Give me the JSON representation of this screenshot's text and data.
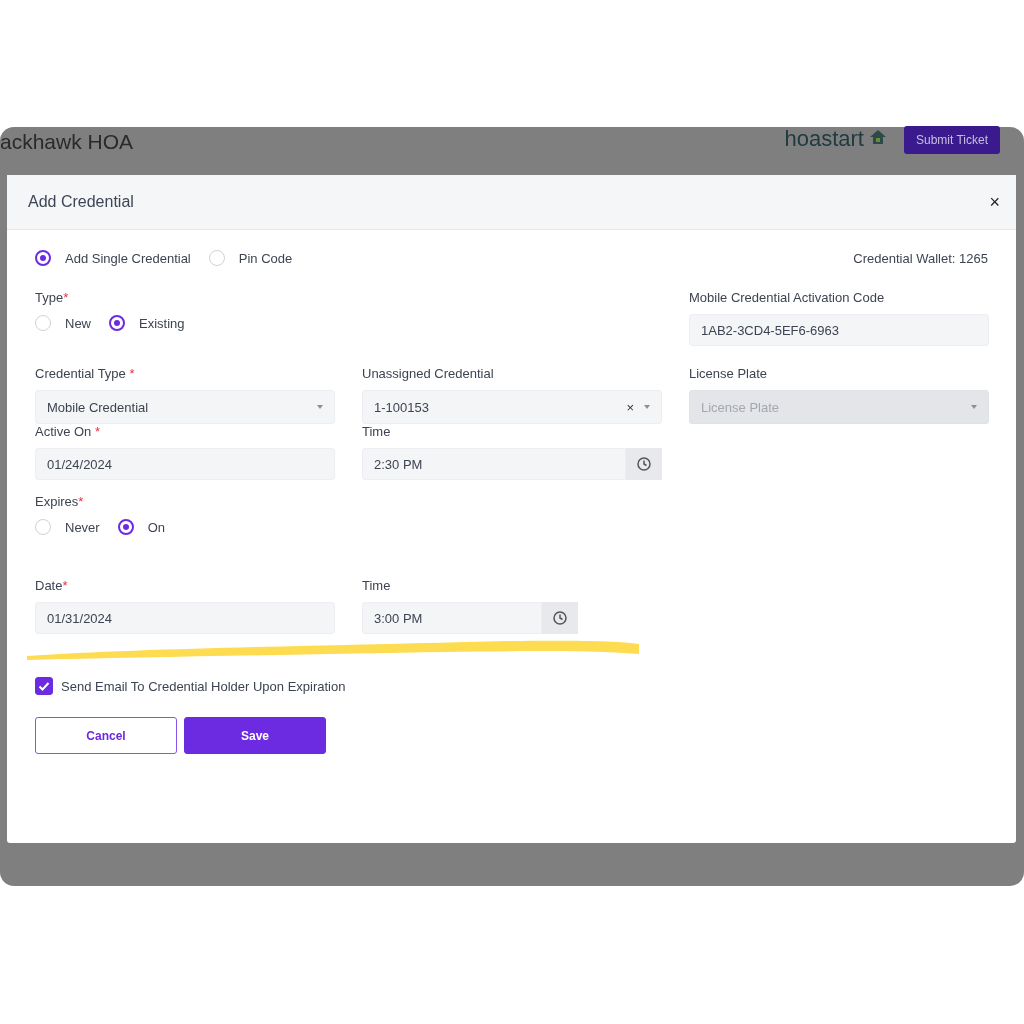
{
  "app_header": {
    "org_name": "ackhawk HOA",
    "logo_text": "hoastart",
    "submit_button": "Submit Ticket"
  },
  "modal": {
    "title": "Add Credential",
    "close": "×",
    "mode_options": [
      {
        "label": "Add Single Credential",
        "selected": true
      },
      {
        "label": "Pin Code",
        "selected": false
      }
    ],
    "wallet": "Credential Wallet: 1265",
    "type": {
      "label": "Type",
      "required_mark": "*",
      "options": [
        {
          "label": "New",
          "selected": false
        },
        {
          "label": "Existing",
          "selected": true
        }
      ]
    },
    "activation_code": {
      "label": "Mobile Credential Activation Code",
      "value": "1AB2-3CD4-5EF6-6963"
    },
    "credential_type": {
      "label": "Credential Type",
      "required_mark": "*",
      "value": "Mobile Credential"
    },
    "unassigned_credential": {
      "label": "Unassigned Credential",
      "value": "1-100153",
      "clear": "×"
    },
    "license_plate": {
      "label": "License Plate",
      "placeholder": "License Plate",
      "disabled": true
    },
    "active_on": {
      "label": "Active On",
      "required_mark": "*",
      "value": "01/24/2024"
    },
    "active_time": {
      "label": "Time",
      "value": "2:30 PM"
    },
    "expires": {
      "label": "Expires",
      "required_mark": "*",
      "options": [
        {
          "label": "Never",
          "selected": false
        },
        {
          "label": "On",
          "selected": true
        }
      ]
    },
    "expire_date": {
      "label": "Date",
      "required_mark": "*",
      "value": "01/31/2024"
    },
    "expire_time": {
      "label": "Time",
      "value": "3:00 PM"
    },
    "send_email": {
      "label": "Send Email To Credential Holder Upon Expiration",
      "checked": true
    },
    "buttons": [
      {
        "label": "Cancel",
        "kind": "secondary"
      },
      {
        "label": "Save",
        "kind": "primary"
      }
    ]
  }
}
